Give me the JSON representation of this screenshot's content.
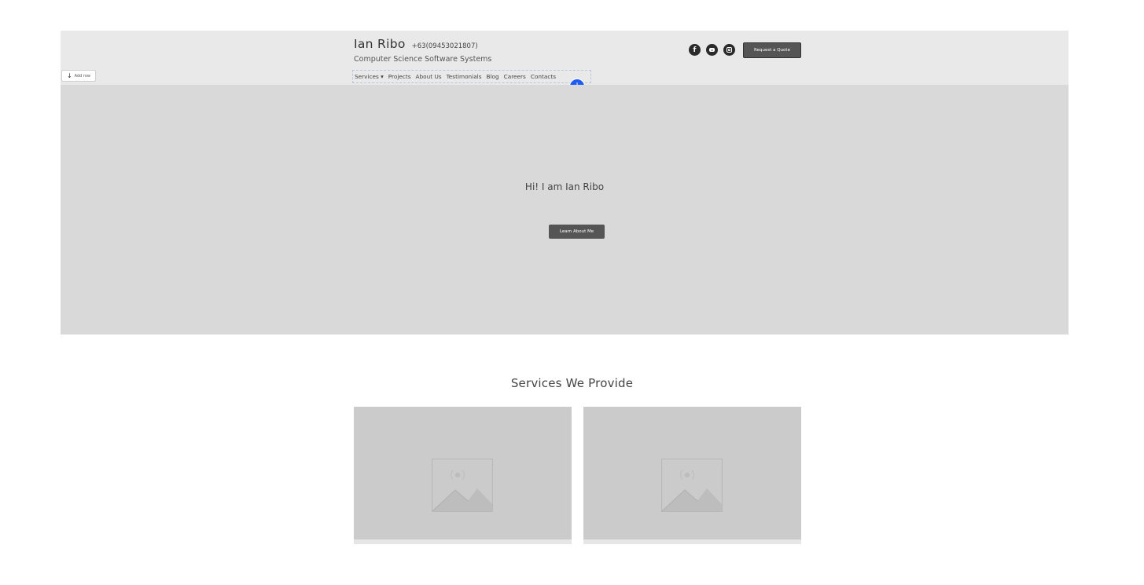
{
  "header": {
    "add_row_label": "Add row",
    "brand_name": "Ian Ribo",
    "phone": "+63(09453021807)",
    "tagline": "Computer Science Software Systems",
    "nav": [
      "Services ▾",
      "Projects",
      "About Us",
      "Testimonials",
      "Blog",
      "Careers",
      "Contacts"
    ],
    "add_button": "+",
    "socials": [
      "facebook-icon",
      "youtube-icon",
      "instagram-icon"
    ],
    "facebook_glyph": "f",
    "quote_button": "Request a Quote",
    "accent": "#1f5cf0"
  },
  "hero": {
    "title": "Hi! I am Ian Ribo",
    "button": "Learn About Me",
    "background": "#d9d9d9"
  },
  "services": {
    "heading": "Services We Provide",
    "cards": [
      {
        "image": "image-placeholder-icon"
      },
      {
        "image": "image-placeholder-icon"
      }
    ]
  }
}
